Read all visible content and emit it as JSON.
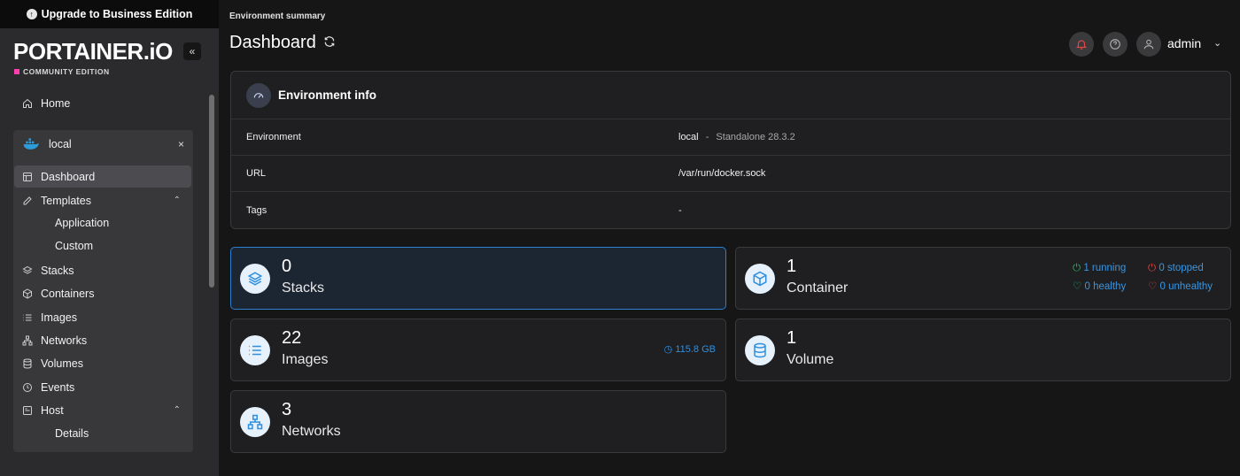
{
  "sidebar": {
    "upgrade_label": "Upgrade to Business Edition",
    "logo": "PORTAINER.iO",
    "edition": "COMMUNITY EDITION",
    "collapse_icon": "«",
    "home_label": "Home",
    "environment": {
      "name": "local",
      "close": "×"
    },
    "items": [
      {
        "label": "Dashboard",
        "icon": "layout-icon"
      },
      {
        "label": "Templates",
        "icon": "edit-icon"
      },
      {
        "label": "Stacks",
        "icon": "layers-icon"
      },
      {
        "label": "Containers",
        "icon": "box-icon"
      },
      {
        "label": "Images",
        "icon": "list-icon"
      },
      {
        "label": "Networks",
        "icon": "network-icon"
      },
      {
        "label": "Volumes",
        "icon": "database-icon"
      },
      {
        "label": "Events",
        "icon": "clock-icon"
      },
      {
        "label": "Host",
        "icon": "host-icon"
      }
    ],
    "template_subitems": [
      "Application",
      "Custom"
    ],
    "host_subitems": [
      "Details"
    ]
  },
  "header": {
    "breadcrumb": "Environment summary",
    "title": "Dashboard",
    "user": "admin"
  },
  "env_info": {
    "title": "Environment info",
    "rows": [
      {
        "key": "Environment",
        "value": "local",
        "sep": "-",
        "extra": "Standalone 28.3.2"
      },
      {
        "key": "URL",
        "value": "/var/run/docker.sock"
      },
      {
        "key": "Tags",
        "value": "-"
      }
    ]
  },
  "cards": {
    "stacks": {
      "count": "0",
      "label": "Stacks"
    },
    "container": {
      "count": "1",
      "label": "Container",
      "running": "1 running",
      "stopped": "0 stopped",
      "healthy": "0 healthy",
      "unhealthy": "0 unhealthy"
    },
    "images": {
      "count": "22",
      "label": "Images",
      "size": "115.8 GB"
    },
    "volume": {
      "count": "1",
      "label": "Volume"
    },
    "networks": {
      "count": "3",
      "label": "Networks"
    }
  },
  "colors": {
    "accent": "#2d8fe0",
    "healthy": "#26b463",
    "danger": "#e04646",
    "edition_mark": "#ff3fb0"
  }
}
